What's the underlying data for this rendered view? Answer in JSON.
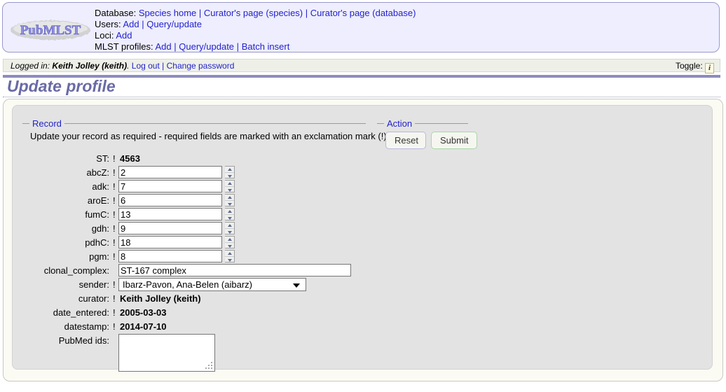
{
  "brand": {
    "logo_text": "PubMLST"
  },
  "nav": {
    "lines": [
      {
        "label": "Database:",
        "links": [
          "Species home",
          "Curator's page (species)",
          "Curator's page (database)"
        ]
      },
      {
        "label": "Users:",
        "links": [
          "Add",
          "Query/update"
        ]
      },
      {
        "label": "Loci:",
        "links": [
          "Add"
        ]
      },
      {
        "label": "MLST profiles:",
        "links": [
          "Add",
          "Query/update",
          "Batch insert"
        ]
      }
    ],
    "separator": "|"
  },
  "loginbar": {
    "prefix": "Logged in:",
    "user": "Keith Jolley (keith)",
    "period": ".",
    "logout": "Log out",
    "separator": "|",
    "change_password": "Change password",
    "toggle_label": "Toggle:",
    "toggle_icon": "i"
  },
  "page": {
    "title": "Update profile"
  },
  "record": {
    "legend": "Record",
    "hint": "Update your record as required - required fields are marked with an exclamation mark (!):",
    "required_mark": "!",
    "fields": [
      {
        "label": "ST:",
        "required": true,
        "type": "static",
        "value": "4563"
      },
      {
        "label": "abcZ:",
        "required": true,
        "type": "number",
        "value": "2"
      },
      {
        "label": "adk:",
        "required": true,
        "type": "number",
        "value": "7"
      },
      {
        "label": "aroE:",
        "required": true,
        "type": "number",
        "value": "6"
      },
      {
        "label": "fumC:",
        "required": true,
        "type": "number",
        "value": "13"
      },
      {
        "label": "gdh:",
        "required": true,
        "type": "number",
        "value": "9"
      },
      {
        "label": "pdhC:",
        "required": true,
        "type": "number",
        "value": "18"
      },
      {
        "label": "pgm:",
        "required": true,
        "type": "number",
        "value": "8"
      },
      {
        "label": "clonal_complex:",
        "required": false,
        "type": "text",
        "value": "ST-167 complex"
      },
      {
        "label": "sender:",
        "required": true,
        "type": "select",
        "value": "Ibarz-Pavon, Ana-Belen (aibarz)"
      },
      {
        "label": "curator:",
        "required": true,
        "type": "static",
        "value": "Keith Jolley (keith)"
      },
      {
        "label": "date_entered:",
        "required": true,
        "type": "static",
        "value": "2005-03-03"
      },
      {
        "label": "datestamp:",
        "required": true,
        "type": "static",
        "value": "2014-07-10"
      },
      {
        "label": "PubMed ids:",
        "required": false,
        "type": "textarea",
        "value": ""
      }
    ]
  },
  "action": {
    "legend": "Action",
    "reset_label": "Reset",
    "submit_label": "Submit"
  },
  "colors": {
    "header_bg": "#eeeeff",
    "header_border": "#9999cc",
    "link": "#2222cc",
    "title": "#6a6aa6",
    "panel_bg": "#e3e3e3",
    "shell_bg": "#fbfbf4",
    "reset_border": "#b8b8e0",
    "submit_border": "#a9d8a9"
  }
}
